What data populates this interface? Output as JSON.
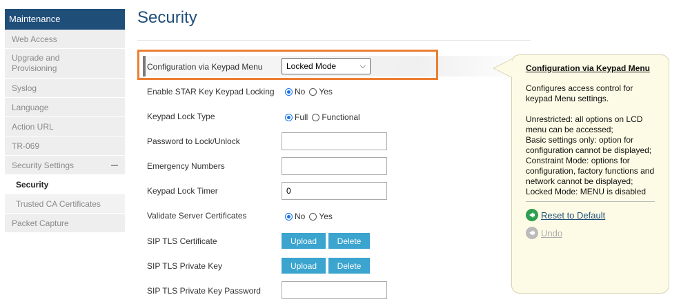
{
  "sidebar": {
    "header": "Maintenance",
    "items": [
      {
        "label": "Web Access"
      },
      {
        "label": "Upgrade and Provisioning"
      },
      {
        "label": "Syslog"
      },
      {
        "label": "Language"
      },
      {
        "label": "Action URL"
      },
      {
        "label": "TR-069"
      },
      {
        "label": "Security Settings"
      },
      {
        "label": "Security"
      },
      {
        "label": "Trusted CA Certificates"
      },
      {
        "label": "Packet Capture"
      }
    ]
  },
  "page": {
    "title": "Security"
  },
  "form": {
    "config_keypad": {
      "label": "Configuration via Keypad Menu",
      "value": "Locked Mode"
    },
    "star_key": {
      "label": "Enable STAR Key Keypad Locking",
      "opt1": "No",
      "opt2": "Yes",
      "selected": "No"
    },
    "lock_type": {
      "label": "Keypad Lock Type",
      "opt1": "Full",
      "opt2": "Functional",
      "selected": "Full"
    },
    "password": {
      "label": "Password to Lock/Unlock",
      "value": ""
    },
    "emergency": {
      "label": "Emergency Numbers",
      "value": ""
    },
    "lock_timer": {
      "label": "Keypad Lock Timer",
      "value": "0"
    },
    "validate_cert": {
      "label": "Validate Server Certificates",
      "opt1": "No",
      "opt2": "Yes",
      "selected": "No"
    },
    "tls_cert": {
      "label": "SIP TLS Certificate",
      "upload": "Upload",
      "delete": "Delete"
    },
    "tls_key": {
      "label": "SIP TLS Private Key",
      "upload": "Upload",
      "delete": "Delete"
    },
    "tls_key_pw": {
      "label": "SIP TLS Private Key Password",
      "value": ""
    }
  },
  "tooltip": {
    "title": "Configuration via Keypad Menu",
    "desc": "Configures access control for keypad Menu settings.",
    "details": [
      "Unrestricted: all options on LCD menu can be accessed;",
      "Basic settings only: option for configuration cannot be displayed;",
      "Constraint Mode: options for configuration, factory functions and network cannot be displayed;",
      "Locked Mode: MENU is disabled"
    ],
    "reset_label": "Reset to Default",
    "undo_label": "Undo"
  },
  "colors": {
    "nav_header": "#1f4e79",
    "highlight_frame": "#ed7d31",
    "button": "#3ba4cf",
    "tooltip_bg": "#fdfbe5",
    "reset_icon": "#2e9f52"
  }
}
